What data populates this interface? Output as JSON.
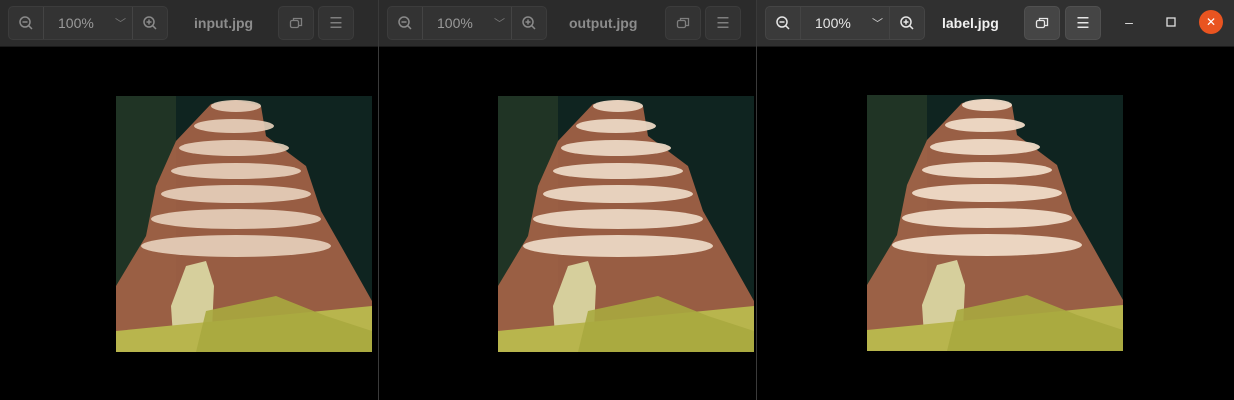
{
  "windows": [
    {
      "title": "input.jpg",
      "zoom": "100%",
      "active": false
    },
    {
      "title": "output.jpg",
      "zoom": "100%",
      "active": false
    },
    {
      "title": "label.jpg",
      "zoom": "100%",
      "active": true
    }
  ],
  "icons": {
    "zoom_out": "zoom-out-icon",
    "zoom_in": "zoom-in-icon",
    "zoom_dropdown": "chevron-down-icon",
    "fit": "restore-icon",
    "menu": "hamburger-icon",
    "minimize": "minimize-icon",
    "maximize": "maximize-icon",
    "close": "close-icon"
  },
  "colors": {
    "header_bg": "#2b2b2b",
    "active_header_bg": "#303030",
    "close_button": "#e95420",
    "image_background": "#0d1f1b"
  }
}
